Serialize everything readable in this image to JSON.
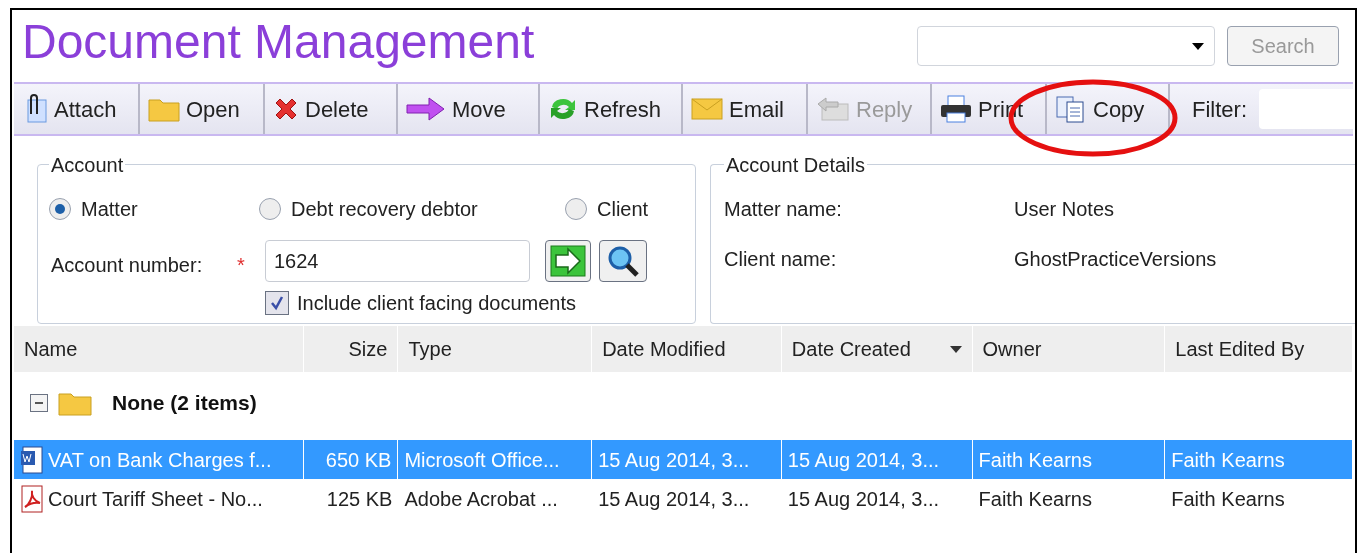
{
  "window": {
    "title": "Document Management"
  },
  "search": {
    "button": "Search"
  },
  "toolbar": [
    {
      "label": "Attach",
      "disabled": false
    },
    {
      "label": "Open",
      "disabled": false
    },
    {
      "label": "Delete",
      "disabled": false
    },
    {
      "label": "Move",
      "disabled": false
    },
    {
      "label": "Refresh",
      "disabled": false
    },
    {
      "label": "Email",
      "disabled": false
    },
    {
      "label": "Reply",
      "disabled": true
    },
    {
      "label": "Print",
      "disabled": false
    },
    {
      "label": "Copy",
      "disabled": false
    }
  ],
  "filter": {
    "label": "Filter:"
  },
  "account": {
    "title": "Account",
    "options": [
      {
        "label": "Matter",
        "selected": true
      },
      {
        "label": "Debt recovery debtor",
        "selected": false
      },
      {
        "label": "Client",
        "selected": false
      }
    ],
    "number_label": "Account number:",
    "required_mark": "*",
    "number": "1624",
    "include": {
      "label": "Include client facing documents",
      "checked": true
    }
  },
  "details": {
    "title": "Account Details",
    "rows": [
      {
        "label": "Matter name:",
        "value": "User Notes"
      },
      {
        "label": "Client name:",
        "value": "GhostPracticeVersions"
      }
    ]
  },
  "table": {
    "columns": [
      {
        "label": "Name",
        "sorted": false
      },
      {
        "label": "Size",
        "sorted": false
      },
      {
        "label": "Type",
        "sorted": false
      },
      {
        "label": "Date Modified",
        "sorted": false
      },
      {
        "label": "Date Created",
        "sorted": true
      },
      {
        "label": "Owner",
        "sorted": false
      },
      {
        "label": "Last Edited By",
        "sorted": false
      }
    ],
    "group": {
      "label": "None (2 items)",
      "expanded": true
    },
    "rows": [
      {
        "kind": "word",
        "selected": true,
        "cells": [
          "VAT on Bank Charges f...",
          "650 KB",
          "Microsoft Office...",
          "15 Aug 2014, 3...",
          "15 Aug 2014, 3...",
          "Faith Kearns",
          "Faith Kearns"
        ]
      },
      {
        "kind": "pdf",
        "selected": false,
        "cells": [
          "Court Tariff Sheet - No...",
          "125 KB",
          "Adobe Acrobat ...",
          "15 Aug 2014, 3...",
          "15 Aug 2014, 3...",
          "Faith Kearns",
          "Faith Kearns"
        ]
      }
    ]
  }
}
